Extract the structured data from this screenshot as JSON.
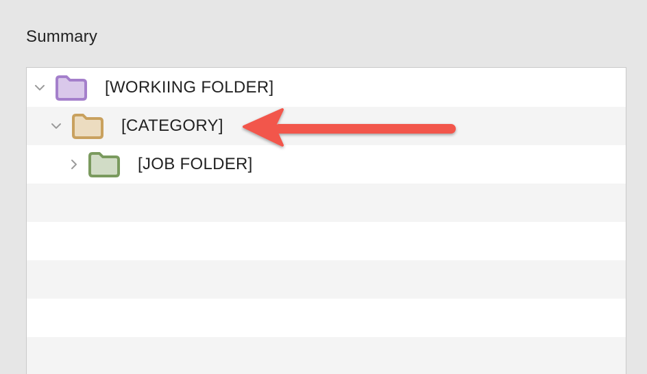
{
  "summary": {
    "title": "Summary"
  },
  "tree": {
    "items": [
      {
        "label": "[WORKIING FOLDER]",
        "expanded": true,
        "folder_color": "#a47fcb",
        "folder_fill": "#d9c8ea",
        "icon": "folder-icon"
      },
      {
        "label": "[CATEGORY]",
        "expanded": true,
        "folder_color": "#c9a15e",
        "folder_fill": "#ecdcc0",
        "icon": "folder-icon"
      },
      {
        "label": "[JOB FOLDER]",
        "expanded": false,
        "folder_color": "#7a9a5e",
        "folder_fill": "#d1dcc6",
        "icon": "folder-icon"
      }
    ]
  },
  "annotation": {
    "arrow_color": "#f2564c",
    "points_to": "[CATEGORY]"
  }
}
